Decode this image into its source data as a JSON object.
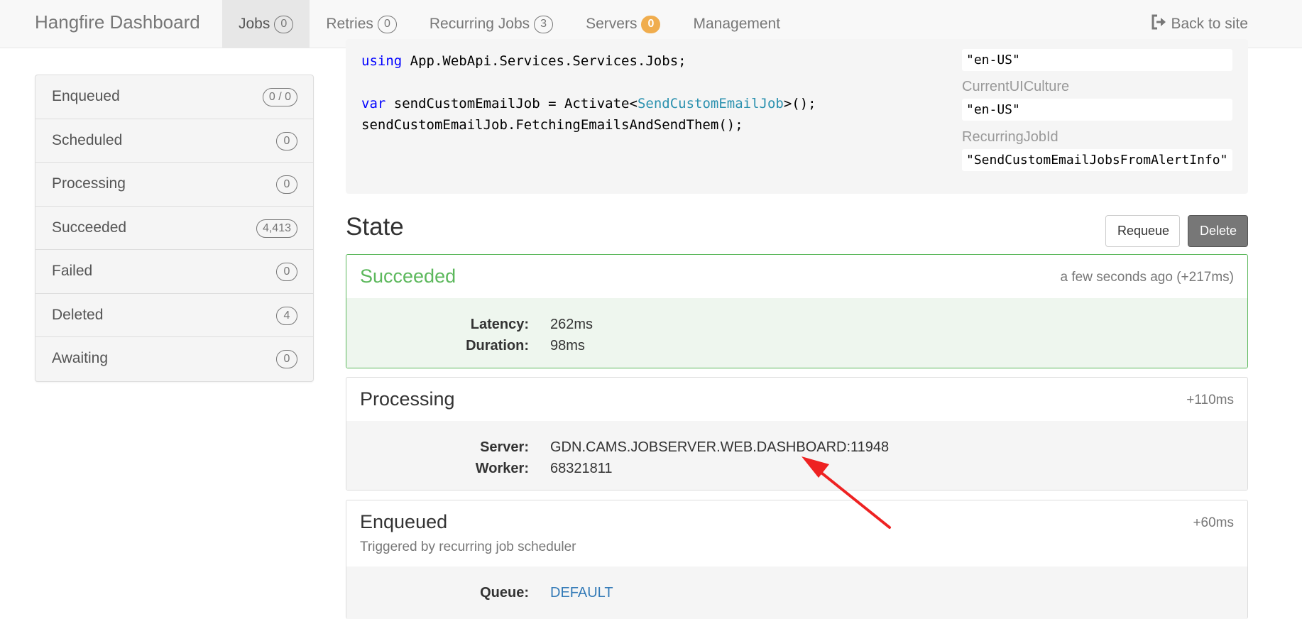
{
  "navbar": {
    "brand": "Hangfire Dashboard",
    "items": [
      {
        "label": "Jobs",
        "badge": "0"
      },
      {
        "label": "Retries",
        "badge": "0"
      },
      {
        "label": "Recurring Jobs",
        "badge": "3"
      },
      {
        "label": "Servers",
        "badge": "0"
      },
      {
        "label": "Management"
      }
    ],
    "back_label": "Back to site"
  },
  "sidebar": {
    "items": [
      {
        "label": "Enqueued",
        "count": "0 / 0"
      },
      {
        "label": "Scheduled",
        "count": "0"
      },
      {
        "label": "Processing",
        "count": "0"
      },
      {
        "label": "Succeeded",
        "count": "4,413"
      },
      {
        "label": "Failed",
        "count": "0"
      },
      {
        "label": "Deleted",
        "count": "4"
      },
      {
        "label": "Awaiting",
        "count": "0"
      }
    ]
  },
  "code": {
    "using_kw": "using",
    "using_ns": " App.WebApi.Services.Services.Jobs;",
    "var_kw": "var",
    "line2_mid": " sendCustomEmailJob = Activate<",
    "type_name": "SendCustomEmailJob",
    "line2_end": ">();",
    "line3": "sendCustomEmailJob.FetchingEmailsAndSendThem();"
  },
  "params": {
    "current_culture_value": "\"en-US\"",
    "ui_culture_label": "CurrentUICulture",
    "ui_culture_value": "\"en-US\"",
    "recurring_label": "RecurringJobId",
    "recurring_value": "\"SendCustomEmailJobsFromAlertInfo\""
  },
  "state": {
    "title": "State",
    "requeue_label": "Requeue",
    "delete_label": "Delete",
    "cards": [
      {
        "title": "Succeeded",
        "time": "a few seconds ago (+217ms)",
        "rows": [
          {
            "key": "Latency:",
            "value": "262ms"
          },
          {
            "key": "Duration:",
            "value": "98ms"
          }
        ]
      },
      {
        "title": "Processing",
        "time": "+110ms",
        "rows": [
          {
            "key": "Server:",
            "value": "GDN.CAMS.JOBSERVER.WEB.DASHBOARD:11948"
          },
          {
            "key": "Worker:",
            "value": "68321811"
          }
        ]
      },
      {
        "title": "Enqueued",
        "time": "+60ms",
        "subtitle": "Triggered by recurring job scheduler",
        "rows": [
          {
            "key": "Queue:",
            "value": "DEFAULT"
          }
        ]
      }
    ]
  },
  "colors": {
    "success": "#5cb85c",
    "warning_badge": "#f0ad4e",
    "link": "#337ab7",
    "annotation_arrow": "#ee2222"
  }
}
